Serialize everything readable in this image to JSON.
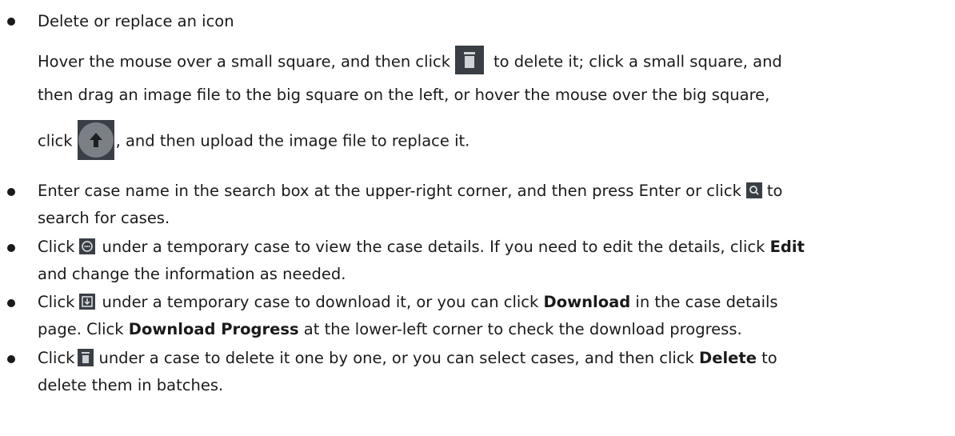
{
  "items": [
    {
      "heading": "Delete or replace an icon",
      "l1a": "Hover the mouse over a small square, and then click",
      "l1b": "to delete it; click a small square, and",
      "l2": "then drag an image file to the big square on the left, or hover the mouse over the big square,",
      "l3a": "click",
      "l3b": ", and then upload the image file to replace it."
    },
    {
      "l1a": "Enter case name in the search box at the upper-right corner, and then press Enter or click",
      "l1b": "to",
      "l2": "search for cases."
    },
    {
      "l1a": "Click",
      "l1b": "under a temporary case to view the case details. If you need to edit the details, click",
      "l1c": "Edit",
      "l2": "and change the information as needed."
    },
    {
      "l1a": "Click",
      "l1b": "under a temporary case to download it, or you can click",
      "l1c": "Download",
      "l1d": "in the case details",
      "l2a": "page. Click",
      "l2b": "Download Progress",
      "l2c": "at the lower-left corner to check the download progress."
    },
    {
      "l1a": "Click",
      "l1b": "under a case to delete it one by one, or you can select cases, and then click",
      "l1c": "Delete",
      "l1d": "to",
      "l2": "delete them in batches."
    }
  ],
  "icons": {
    "trash": "trash-icon",
    "upload": "upload-arrow-icon",
    "search": "search-icon",
    "details": "more-details-icon",
    "download": "download-icon"
  },
  "colors": {
    "icon_bg": "#3a3f45",
    "icon_fg": "#cfd3d7",
    "text": "#1a1a1a"
  }
}
